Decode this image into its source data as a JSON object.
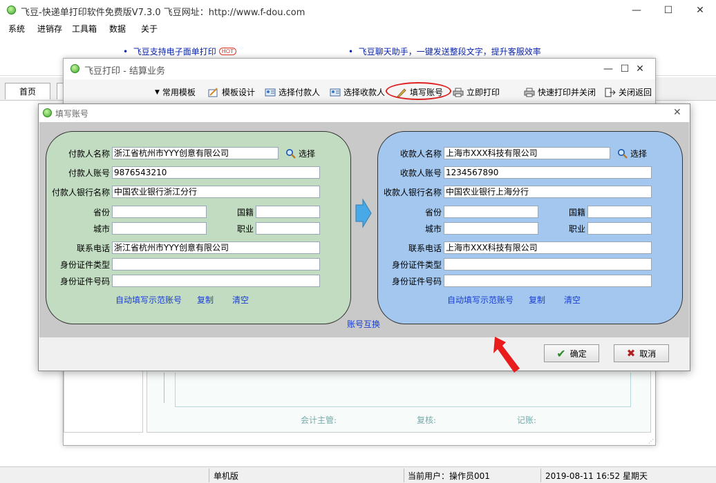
{
  "app": {
    "title": "飞豆-快递单打印软件免费版V7.3.0  飞豆网址：http://www.f-dou.com",
    "min": "—",
    "max": "☐",
    "close": "✕"
  },
  "menu": [
    "系统",
    "进销存",
    "工具箱",
    "数据",
    "关于"
  ],
  "ads": [
    {
      "text": "飞豆支持电子面单打印",
      "hot": "HOT"
    },
    {
      "text": "飞豆聊天助手，一键发送整段文字，提升客服效率"
    }
  ],
  "tabs": {
    "home": "首页"
  },
  "status": {
    "mode": "单机版",
    "user": "当前用户：操作员001",
    "datetime": "2019-08-11 16:52 星期天"
  },
  "settle": {
    "title": "飞豆打印 - 结算业务",
    "toolbar": [
      "常用模板",
      "模板设计",
      "选择付款人",
      "选择收款人",
      "填写账号",
      "立即打印",
      "快速打印并关闭",
      "关闭返回"
    ],
    "preview": {
      "accountant": "会计主管:",
      "reviewer": "复核:",
      "bookkeeper": "记账:"
    }
  },
  "dialog": {
    "title": "填写账号",
    "close": "✕",
    "swap": "账号互换",
    "ok": "确定",
    "cancel": "取消",
    "payer": {
      "name_label": "付款人名称",
      "name": "浙江省杭州市YYY创意有限公司",
      "select": "选择",
      "acct_label": "付款人账号",
      "acct": "9876543210",
      "bank_label": "付款人银行名称",
      "bank": "中国农业银行浙江分行",
      "prov_label": "省份",
      "prov": "",
      "country_label": "国籍",
      "country": "",
      "city_label": "城市",
      "city": "",
      "job_label": "职业",
      "job": "",
      "phone_label": "联系电话",
      "phone": "浙江省杭州市YYY创意有限公司",
      "idtype_label": "身份证件类型",
      "idtype": "",
      "idno_label": "身份证件号码",
      "idno": "",
      "auto": "自动填写示范账号",
      "copy": "复制",
      "clear": "清空"
    },
    "payee": {
      "name_label": "收款人名称",
      "name": "上海市XXX科技有限公司",
      "select": "选择",
      "acct_label": "收款人账号",
      "acct": "1234567890",
      "bank_label": "收款人银行名称",
      "bank": "中国农业银行上海分行",
      "prov_label": "省份",
      "prov": "",
      "country_label": "国籍",
      "country": "",
      "city_label": "城市",
      "city": "",
      "job_label": "职业",
      "job": "",
      "phone_label": "联系电话",
      "phone": "上海市XXX科技有限公司",
      "idtype_label": "身份证件类型",
      "idtype": "",
      "idno_label": "身份证件号码",
      "idno": "",
      "auto": "自动填写示范账号",
      "copy": "复制",
      "clear": "清空"
    }
  },
  "colors": {
    "payer_panel": "#c2dcc1",
    "payee_panel": "#a3c7ee",
    "link": "#1a3ed1",
    "highlight": "#e02020"
  }
}
